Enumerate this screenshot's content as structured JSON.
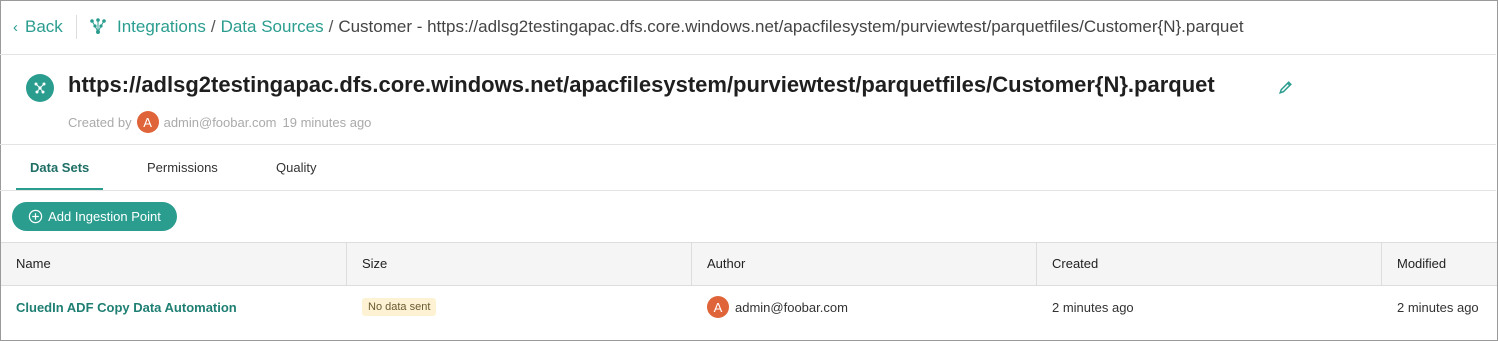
{
  "nav": {
    "back_label": "Back",
    "breadcrumbs": {
      "integrations": "Integrations",
      "sep1": "/",
      "data_sources": "Data Sources",
      "sep2": "/",
      "current": "Customer - https://adlsg2testingapac.dfs.core.windows.net/apacfilesystem/purviewtest/parquetfiles/Customer{N}.parquet"
    }
  },
  "header": {
    "title": "https://adlsg2testingapac.dfs.core.windows.net/apacfilesystem/purviewtest/parquetfiles/Customer{N}.parquet",
    "created_by_label": "Created by",
    "avatar_initial": "A",
    "user": "admin@foobar.com",
    "time": "19 minutes ago"
  },
  "tabs": [
    {
      "label": "Data Sets",
      "active": true
    },
    {
      "label": "Permissions",
      "active": false
    },
    {
      "label": "Quality",
      "active": false
    }
  ],
  "actions": {
    "add_ingestion_label": "Add Ingestion Point"
  },
  "table": {
    "columns": [
      "Name",
      "Size",
      "Author",
      "Created",
      "Modified"
    ],
    "rows": [
      {
        "name": "CluedIn ADF Copy Data Automation",
        "size": "No data sent",
        "author_initial": "A",
        "author": "admin@foobar.com",
        "created": "2 minutes ago",
        "modified": "2 minutes ago"
      }
    ]
  },
  "colors": {
    "accent": "#2a9d8f",
    "avatar": "#e0643a",
    "badge_bg": "#fdf2d3"
  }
}
